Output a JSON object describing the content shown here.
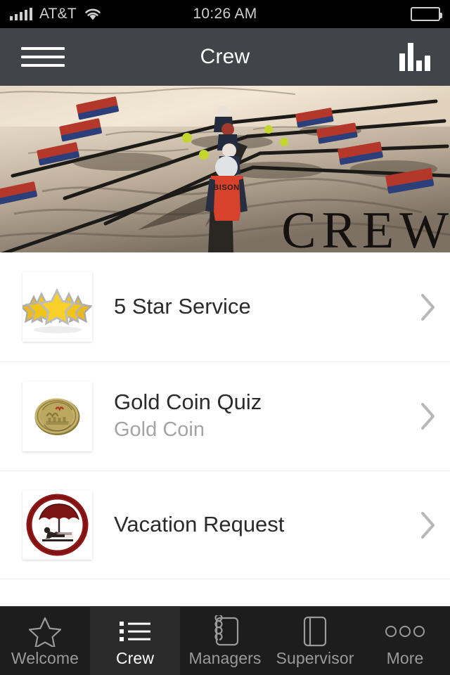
{
  "status_bar": {
    "carrier": "AT&T",
    "time": "10:26 AM",
    "signal_icon": "signal-bars-icon",
    "wifi_icon": "wifi-icon",
    "battery_icon": "battery-icon"
  },
  "nav_bar": {
    "title": "Crew",
    "menu_icon": "hamburger-menu-icon",
    "chart_icon": "bar-chart-icon",
    "background_color": "#414448",
    "title_color": "#ffffff"
  },
  "hero": {
    "caption": "CREW",
    "alt": "rowing-crew-photo"
  },
  "list": {
    "items": [
      {
        "title": "5 Star Service",
        "subtitle": "",
        "thumb_icon": "five-gold-stars-thumbnail",
        "chevron_icon": "chevron-right-icon"
      },
      {
        "title": "Gold Coin Quiz",
        "subtitle": "Gold Coin",
        "thumb_icon": "gold-coin-thumbnail",
        "chevron_icon": "chevron-right-icon"
      },
      {
        "title": "Vacation Request",
        "subtitle": "",
        "thumb_icon": "vacation-umbrella-thumbnail",
        "chevron_icon": "chevron-right-icon"
      }
    ]
  },
  "tab_bar": {
    "active_index": 1,
    "tabs": [
      {
        "label": "Welcome",
        "icon": "star-outline-icon"
      },
      {
        "label": "Crew",
        "icon": "bulleted-list-icon"
      },
      {
        "label": "Managers",
        "icon": "spiral-notebook-icon"
      },
      {
        "label": "Supervisor",
        "icon": "book-cover-icon"
      },
      {
        "label": "More",
        "icon": "ellipsis-circles-icon"
      }
    ]
  },
  "colors": {
    "nav_background": "#414448",
    "tab_background": "#1d1d1d",
    "tab_active_background": "#2b2b2b",
    "tab_inactive_text": "#9a9a9a",
    "title_text": "#2b2b2b",
    "subtitle_text": "#a4a4a4",
    "divider": "#ededed",
    "chevron": "#b8b8b8",
    "vacation_red": "#8e1616",
    "star_gold": "#f5c518",
    "coin_gold": "#b5a359"
  }
}
